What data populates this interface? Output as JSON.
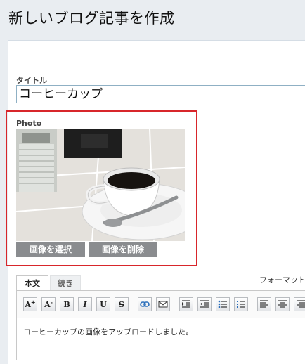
{
  "page": {
    "title": "新しいブログ記事を作成"
  },
  "form": {
    "title_label": "タイトル",
    "title_value": "コーヒーカップ",
    "photo_label": "Photo",
    "select_image_label": "画像を選択",
    "delete_image_label": "画像を削除"
  },
  "editor": {
    "tabs": [
      {
        "label": "本文",
        "active": true
      },
      {
        "label": "続き",
        "active": false
      }
    ],
    "format_label": "フォーマット:",
    "toolbar_icons": [
      "font-size-increase-icon",
      "font-size-decrease-icon",
      "bold-icon",
      "italic-icon",
      "underline-icon",
      "strikethrough-icon",
      "link-icon",
      "email-icon",
      "indent-icon",
      "outdent-icon",
      "bulleted-list-icon",
      "numbered-list-icon",
      "align-left-icon",
      "align-center-icon",
      "align-right-icon"
    ],
    "body_text": "コーヒーカップの画像をアップロードしました。"
  },
  "colors": {
    "highlight_border": "#d8262b",
    "button_gray": "#8a8c8f"
  }
}
